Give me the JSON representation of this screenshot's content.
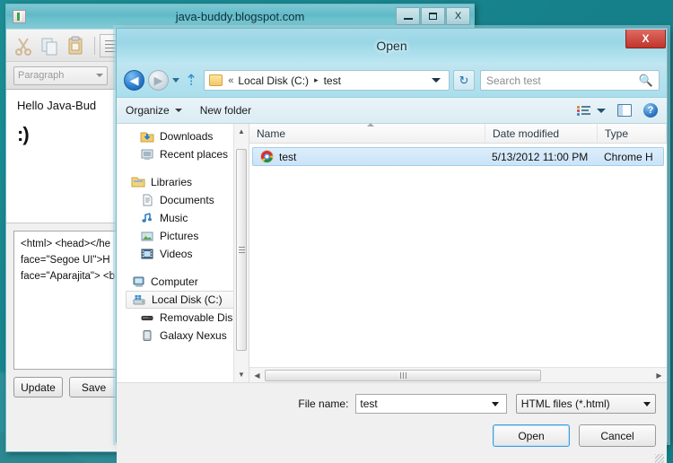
{
  "desktop": {
    "bg_color": "#17838c"
  },
  "background_window": {
    "title": "java-buddy.blogspot.com",
    "icon": "app-icon",
    "window_buttons": [
      {
        "name": "minimize",
        "label": ""
      },
      {
        "name": "maximize",
        "label": ""
      },
      {
        "name": "close",
        "label": "X"
      }
    ],
    "toolbar": {
      "icons": [
        "cut-icon",
        "copy-icon",
        "paste-icon",
        "align-icon"
      ],
      "paragraph_combo": "Paragraph"
    },
    "editor": {
      "line1": "Hello Java-Bud",
      "line2": ":)"
    },
    "source_lines": [
      "<html> <head></he",
      "face=\"Segoe UI\">H",
      "face=\"Aparajita\"> <b"
    ],
    "buttons": [
      {
        "label": "Update"
      },
      {
        "label": "Save"
      }
    ]
  },
  "dialog": {
    "title": "Open",
    "close_label": "X",
    "nav": {
      "back_icon": "back-arrow-icon",
      "forward_icon": "forward-arrow-icon",
      "history_dropdown_icon": "chevron-down-icon",
      "up_icon": "up-arrow-icon",
      "address_chevrons": "«",
      "path_parts": [
        "Local Disk (C:)",
        "test"
      ],
      "path_separator": "▸",
      "refresh_icon": "refresh-icon",
      "search_placeholder": "Search test",
      "search_value": "",
      "search_icon": "magnifier-icon"
    },
    "command_bar": {
      "organize": "Organize",
      "new_folder": "New folder",
      "view_icon": "change-view-icon",
      "view_caret_icon": "chevron-down-icon",
      "preview_pane_icon": "preview-pane-icon",
      "help_icon": "help-icon",
      "help_glyph": "?"
    },
    "nav_pane": {
      "items": [
        {
          "label": "Downloads",
          "icon": "downloads-folder-icon",
          "indent": true,
          "selected": false
        },
        {
          "label": "Recent places",
          "icon": "recent-places-icon",
          "indent": true,
          "selected": false
        },
        {
          "label": "Libraries",
          "icon": "libraries-icon",
          "indent": false,
          "selected": false
        },
        {
          "label": "Documents",
          "icon": "documents-icon",
          "indent": true,
          "selected": false
        },
        {
          "label": "Music",
          "icon": "music-icon",
          "indent": true,
          "selected": false
        },
        {
          "label": "Pictures",
          "icon": "pictures-icon",
          "indent": true,
          "selected": false
        },
        {
          "label": "Videos",
          "icon": "videos-icon",
          "indent": true,
          "selected": false
        },
        {
          "label": "Computer",
          "icon": "computer-icon",
          "indent": false,
          "selected": false
        },
        {
          "label": "Local Disk (C:)",
          "icon": "local-disk-icon",
          "indent": true,
          "selected": true
        },
        {
          "label": "Removable Disk (",
          "icon": "removable-disk-icon",
          "indent": true,
          "selected": false
        },
        {
          "label": "Galaxy Nexus",
          "icon": "portable-device-icon",
          "indent": true,
          "selected": false
        }
      ],
      "scroll_up_glyph": "▲",
      "scroll_down_glyph": "▼"
    },
    "file_list": {
      "columns": [
        "Name",
        "Date modified",
        "Type"
      ],
      "sort_column": "Name",
      "rows": [
        {
          "name": "test",
          "date_modified": "5/13/2012 11:00 PM",
          "type": "Chrome H",
          "icon": "chrome-file-icon",
          "selected": true
        }
      ],
      "hscroll_left_glyph": "◀",
      "hscroll_right_glyph": "▶"
    },
    "footer": {
      "file_name_label": "File name:",
      "file_name_value": "test",
      "file_name_placeholder": "File name",
      "file_type_value": "HTML files (*.html)",
      "open_button": "Open",
      "cancel_button": "Cancel"
    }
  }
}
